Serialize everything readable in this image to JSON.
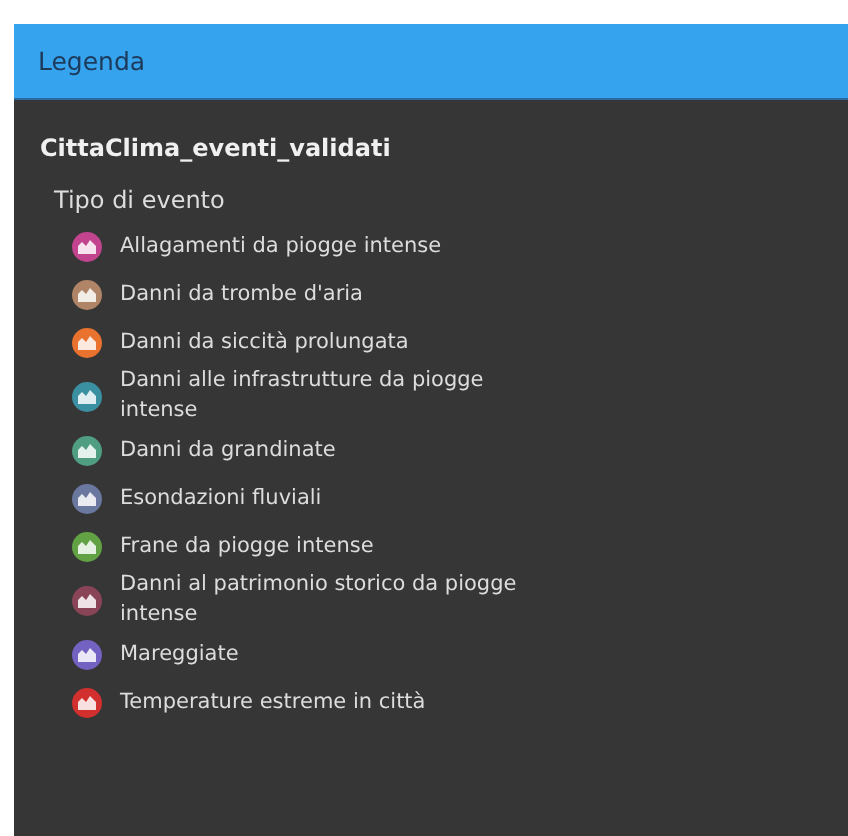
{
  "panel": {
    "title": "Legenda"
  },
  "layer": {
    "name": "CittaClima_eventi_validati",
    "field": "Tipo di evento",
    "items": [
      {
        "label": "Allagamenti da piogge intense",
        "color": "#c2448f"
      },
      {
        "label": "Danni da trombe d'aria",
        "color": "#b08466"
      },
      {
        "label": "Danni da siccità prolungata",
        "color": "#e8722e"
      },
      {
        "label": "Danni alle infrastrutture da piogge intense",
        "color": "#3a8fa0"
      },
      {
        "label": "Danni da grandinate",
        "color": "#4f9e82"
      },
      {
        "label": "Esondazioni fluviali",
        "color": "#6a78a0"
      },
      {
        "label": "Frane da piogge intense",
        "color": "#62a244"
      },
      {
        "label": "Danni al patrimonio storico da piogge intense",
        "color": "#8a4458"
      },
      {
        "label": "Mareggiate",
        "color": "#7362c2"
      },
      {
        "label": "Temperature estreme in città",
        "color": "#d2302e"
      }
    ]
  }
}
